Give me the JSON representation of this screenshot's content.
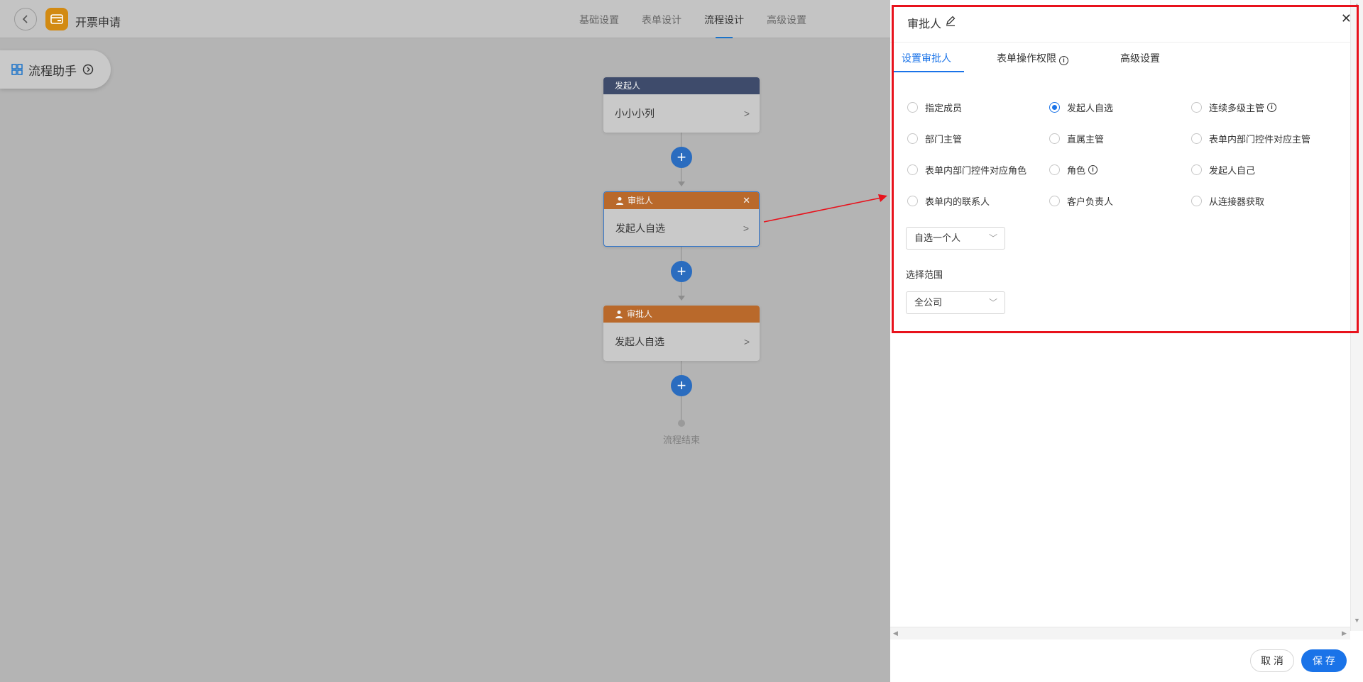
{
  "app": {
    "title": "开票申请",
    "accent_color": "#d28a12"
  },
  "top_tabs": [
    {
      "label": "基础设置",
      "active": false
    },
    {
      "label": "表单设计",
      "active": false
    },
    {
      "label": "流程设计",
      "active": true
    },
    {
      "label": "高级设置",
      "active": false
    }
  ],
  "assistant": {
    "label": "流程助手"
  },
  "flow": {
    "nodes": [
      {
        "type": "starter",
        "header": "发起人",
        "body": "小小小列",
        "color": "#3e4b6b"
      },
      {
        "type": "approver",
        "header": "审批人",
        "body": "发起人自选",
        "color": "#b9692b",
        "selected": true
      },
      {
        "type": "approver",
        "header": "审批人",
        "body": "发起人自选",
        "color": "#b9692b",
        "selected": false
      }
    ],
    "end_label": "流程结束"
  },
  "panel": {
    "title": "审批人",
    "tabs": [
      {
        "label": "设置审批人",
        "active": true
      },
      {
        "label": "表单操作权限",
        "info": true,
        "active": false
      },
      {
        "label": "高级设置",
        "active": false
      }
    ],
    "options": [
      {
        "label": "指定成员",
        "checked": false
      },
      {
        "label": "发起人自选",
        "checked": true
      },
      {
        "label": "连续多级主管",
        "checked": false,
        "info": true
      },
      {
        "label": "部门主管",
        "checked": false
      },
      {
        "label": "直属主管",
        "checked": false
      },
      {
        "label": "表单内部门控件对应主管",
        "checked": false
      },
      {
        "label": "表单内部门控件对应角色",
        "checked": false
      },
      {
        "label": "角色",
        "checked": false,
        "info": true
      },
      {
        "label": "发起人自己",
        "checked": false
      },
      {
        "label": "表单内的联系人",
        "checked": false
      },
      {
        "label": "客户负责人",
        "checked": false
      },
      {
        "label": "从连接器获取",
        "checked": false
      }
    ],
    "mode_select": {
      "value": "自选一个人"
    },
    "range_label": "选择范围",
    "range_select": {
      "value": "全公司"
    },
    "primary_color": "#1a73e8"
  },
  "footer": {
    "cancel_label": "取 消",
    "save_label": "保 存"
  },
  "annotation": {
    "box_color": "#e8121c"
  }
}
